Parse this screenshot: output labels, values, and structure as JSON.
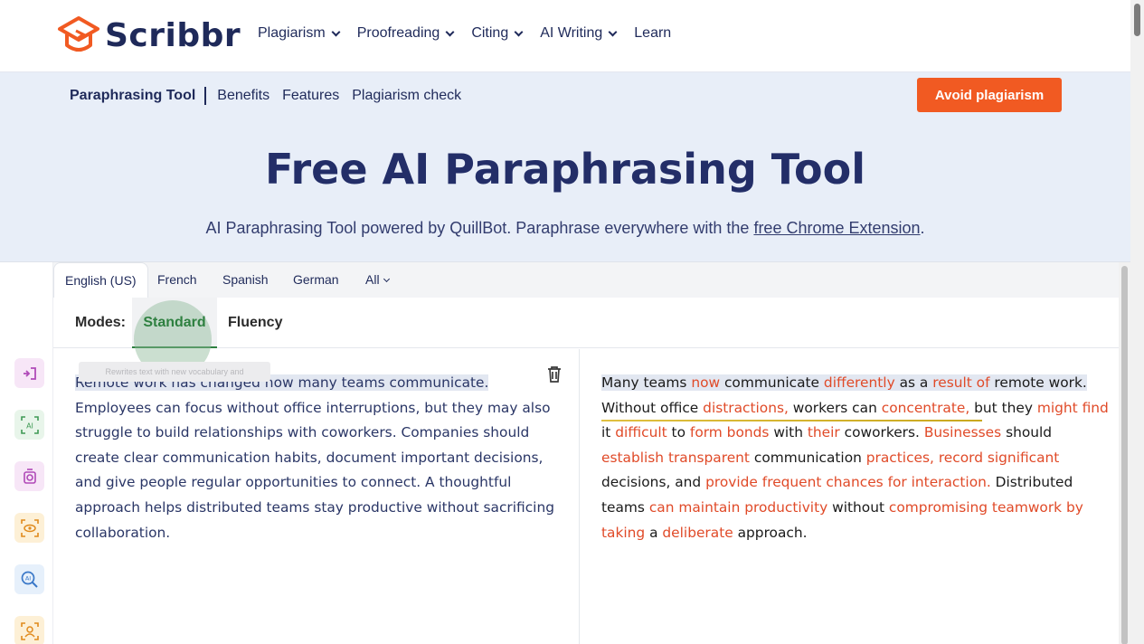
{
  "brand": {
    "name": "Scribbr",
    "accent": "#f15a22",
    "primary": "#1f2a5a"
  },
  "nav": {
    "items": [
      {
        "label": "Plagiarism",
        "dropdown": true
      },
      {
        "label": "Proofreading",
        "dropdown": true
      },
      {
        "label": "Citing",
        "dropdown": true
      },
      {
        "label": "AI Writing",
        "dropdown": true
      },
      {
        "label": "Learn",
        "dropdown": false
      }
    ]
  },
  "subnav": {
    "current": "Paraphrasing Tool",
    "links": [
      "Benefits",
      "Features",
      "Plagiarism check"
    ],
    "cta": "Avoid plagiarism"
  },
  "hero": {
    "title": "Free AI Paraphrasing Tool",
    "subtitle_prefix": "AI Paraphrasing Tool powered by QuillBot. Paraphrase everywhere with the ",
    "subtitle_link": "free Chrome Extension",
    "subtitle_suffix": "."
  },
  "tool": {
    "languages": [
      "English (US)",
      "French",
      "Spanish",
      "German",
      "All"
    ],
    "active_language": "English (US)",
    "modes_label": "Modes:",
    "modes": [
      "Standard",
      "Fluency"
    ],
    "active_mode": "Standard",
    "tooltip": "Rewrites text with new vocabulary and",
    "rail_icons": [
      "paraphrase-icon",
      "ai-detector-icon",
      "grammar-check-icon",
      "summarize-icon",
      "ai-search-icon",
      "humanizer-icon"
    ],
    "input": {
      "segments": [
        {
          "text": "Remote work has changed how many teams communicate.",
          "hl": true
        },
        {
          "text": " Employees can focus without office interruptions, but they may also struggle to build relationships with coworkers. Companies should create clear communication habits, document important decisions, and give people regular opportunities to connect. A thoughtful approach helps distributed teams stay productive without sacrificing collaboration.",
          "hl": false
        }
      ]
    },
    "output": {
      "segments": [
        {
          "t": "Many teams ",
          "c": false,
          "hl": true
        },
        {
          "t": "now",
          "c": true,
          "hl": true
        },
        {
          "t": " communicate ",
          "c": false,
          "hl": true
        },
        {
          "t": "differently",
          "c": true,
          "hl": true
        },
        {
          "t": " as a ",
          "c": false,
          "hl": true
        },
        {
          "t": "result of",
          "c": true,
          "hl": true
        },
        {
          "t": " remote work.",
          "c": false,
          "hl": true
        },
        {
          "t": " Without office ",
          "c": false,
          "hl": false
        },
        {
          "t": "distractions,",
          "c": true,
          "hl": false
        },
        {
          "t": " workers can ",
          "c": false,
          "hl": false
        },
        {
          "t": "concentrate,",
          "c": true,
          "hl": false
        },
        {
          "t": " but they ",
          "c": false,
          "hl": false
        },
        {
          "t": "might find",
          "c": true,
          "hl": false
        },
        {
          "t": " it ",
          "c": false,
          "hl": false
        },
        {
          "t": "difficult",
          "c": true,
          "hl": false
        },
        {
          "t": " to ",
          "c": false,
          "hl": false
        },
        {
          "t": "form bonds",
          "c": true,
          "hl": false
        },
        {
          "t": " with ",
          "c": false,
          "hl": false
        },
        {
          "t": "their",
          "c": true,
          "hl": false
        },
        {
          "t": " coworkers. ",
          "c": false,
          "hl": false
        },
        {
          "t": "Businesses",
          "c": true,
          "hl": false
        },
        {
          "t": " should ",
          "c": false,
          "hl": false
        },
        {
          "t": "establish transparent",
          "c": true,
          "hl": false
        },
        {
          "t": " communication ",
          "c": false,
          "hl": false
        },
        {
          "t": "practices, record significant",
          "c": true,
          "hl": false
        },
        {
          "t": " decisions, and ",
          "c": false,
          "hl": false
        },
        {
          "t": "provide frequent chances for interaction.",
          "c": true,
          "hl": false
        },
        {
          "t": " Distributed teams ",
          "c": false,
          "hl": false
        },
        {
          "t": "can maintain productivity",
          "c": true,
          "hl": false
        },
        {
          "t": " without ",
          "c": false,
          "hl": false
        },
        {
          "t": "compromising teamwork by taking",
          "c": true,
          "hl": false
        },
        {
          "t": " a ",
          "c": false,
          "hl": false
        },
        {
          "t": "deliberate",
          "c": true,
          "hl": false
        },
        {
          "t": " approach.",
          "c": false,
          "hl": false
        }
      ]
    }
  }
}
